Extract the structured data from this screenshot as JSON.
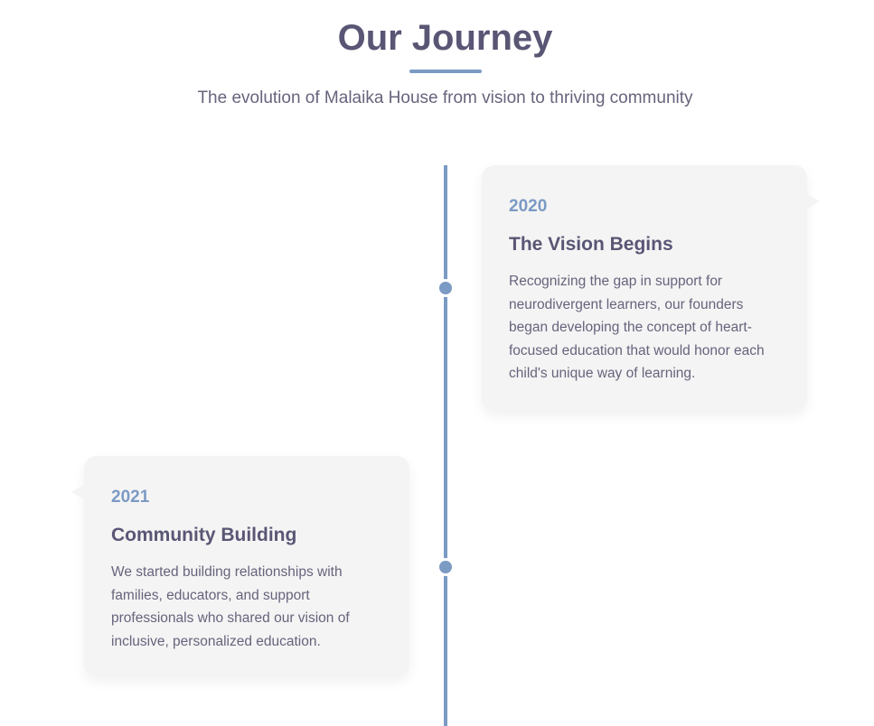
{
  "header": {
    "title": "Our Journey",
    "subtitle": "The evolution of Malaika House from vision to thriving community"
  },
  "colors": {
    "accent": "#7b9ac4",
    "heading": "#595675",
    "body_text": "#66647c",
    "card_background": "#f4f4f4"
  },
  "timeline": {
    "items": [
      {
        "year": "2020",
        "title": "The Vision Begins",
        "text": "Recognizing the gap in support for neurodivergent learners, our founders began developing the concept of heart-focused education that would honor each child's unique way of learning."
      },
      {
        "year": "2021",
        "title": "Community Building",
        "text": "We started building relationships with families, educators, and support professionals who shared our vision of inclusive, personalized education."
      }
    ]
  }
}
